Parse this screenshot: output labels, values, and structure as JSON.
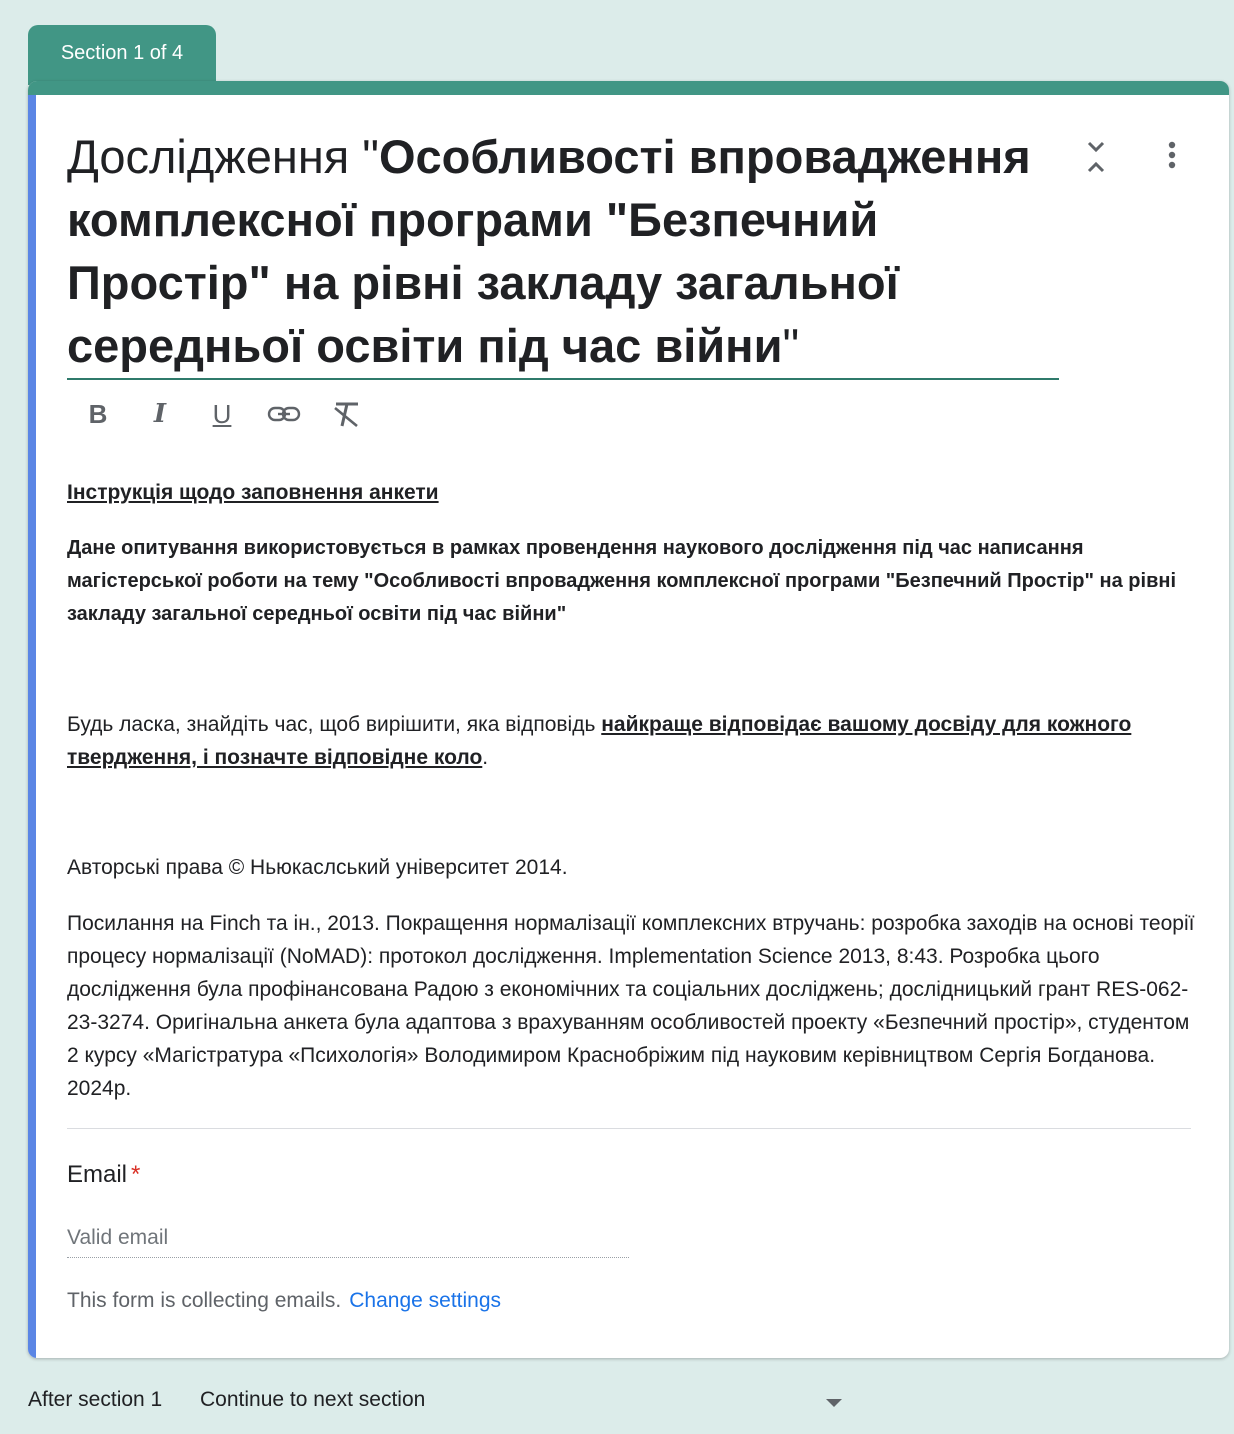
{
  "section_tab": {
    "label": "Section 1 of 4"
  },
  "colors": {
    "accent_green": "#419685",
    "left_bar_blue": "#5b86e5",
    "required_red": "#d93025",
    "link_blue": "#1a73e8"
  },
  "header": {
    "title_prefix": "Дослідження \"",
    "title_bold": "Особливості впровадження комплексної програми \"Безпечний Простір\" на рівні закладу загальної середньої освіти під час війни",
    "title_suffix": "\"",
    "icons": {
      "collapse": "collapse-icon",
      "more": "more-vert-icon"
    }
  },
  "toolbar": {
    "bold_label": "B",
    "italic_label": "I",
    "underline_label": "U",
    "link_icon": "link-icon",
    "clear_format_icon": "clear-format-icon"
  },
  "description": {
    "heading": "Інструкція щодо заповнення анкети",
    "bold_paragraph": "Дане опитування використовується в рамках провендення  наукового дослідження під час написання магістерської роботи на тему \"Особливості впровадження комплексної програми \"Безпечний Простір\" на рівні закладу загальної середньої освіти під час війни\"",
    "please_prefix": "Будь ласка, знайдіть час, щоб вирішити, яка відповідь ",
    "please_emphasis": "найкраще відповідає вашому досвіду для кожного твердження, і позначте відповідне коло",
    "please_suffix": ".",
    "copyright": "Авторські права © Ньюкаслський університет 2014.",
    "reference": "Посилання на Finch та ін., 2013. Покращення нормалізації комплексних втручань: розробка заходів на основі теорії процесу нормалізації (NoMAD): протокол дослідження. Implementation Science 2013, 8:43. Розробка цього дослідження була профінансована Радою з економічних та соціальних досліджень; дослідницький грант RES-062-23-3274. Оригінальна анкета була адаптова з врахуванням особливостей проекту «Безпечний простір», студентом 2 курсу «Магістратура «Психологія» Володимиром Краснобріжим під науковим керівництвом Сергія Богданова. 2024р."
  },
  "email": {
    "label": "Email",
    "required_mark": "*",
    "placeholder": "Valid email",
    "value": "",
    "collecting_text": "This form is collecting emails.",
    "change_settings": "Change settings"
  },
  "after_section": {
    "label": "After section 1",
    "selected": "Continue to next section"
  }
}
